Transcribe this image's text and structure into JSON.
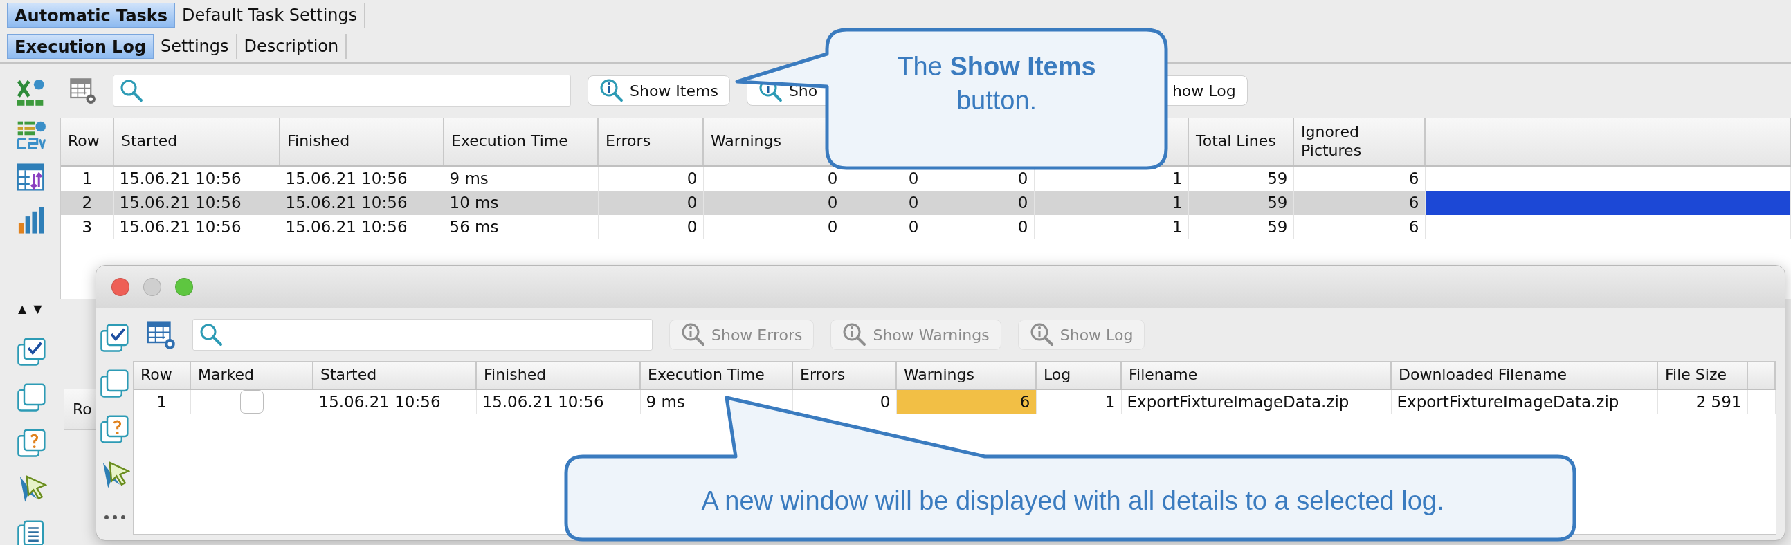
{
  "top_tabs": [
    {
      "label": "Automatic Tasks",
      "selected": true
    },
    {
      "label": "Default Task Settings",
      "selected": false
    }
  ],
  "sub_tabs": [
    {
      "label": "Execution Log",
      "selected": true
    },
    {
      "label": "Settings",
      "selected": false
    },
    {
      "label": "Description",
      "selected": false
    }
  ],
  "toolbar": {
    "buttons": [
      {
        "label": "Show Items",
        "disabled": false
      },
      {
        "label": "Sho",
        "disabled": false
      },
      {
        "label": "how Log",
        "disabled": false
      }
    ]
  },
  "table": {
    "columns": [
      "Row",
      "Started",
      "Finished",
      "Execution Time",
      "Errors",
      "Warnings",
      "",
      "",
      "",
      "Total Lines",
      "Ignored Pictures"
    ],
    "rows": [
      {
        "cells": [
          "1",
          "15.06.21 10:56",
          "15.06.21 10:56",
          "9 ms",
          "0",
          "0",
          "0",
          "0",
          "1",
          "59",
          "6"
        ],
        "selected": false
      },
      {
        "cells": [
          "2",
          "15.06.21 10:56",
          "15.06.21 10:56",
          "10 ms",
          "0",
          "0",
          "0",
          "0",
          "1",
          "59",
          "6"
        ],
        "selected": true
      },
      {
        "cells": [
          "3",
          "15.06.21 10:56",
          "15.06.21 10:56",
          "56 ms",
          "0",
          "0",
          "0",
          "0",
          "1",
          "59",
          "6"
        ],
        "selected": false
      }
    ]
  },
  "splitter": [
    "▲",
    "▼"
  ],
  "lower_table": {
    "columns": [
      "Ro"
    ]
  },
  "detail_window": {
    "toolbar": {
      "buttons": [
        {
          "label": "Show Errors",
          "disabled": true
        },
        {
          "label": "Show Warnings",
          "disabled": true
        },
        {
          "label": "Show Log",
          "disabled": true
        }
      ]
    },
    "table": {
      "columns": [
        "Row",
        "Marked",
        "Started",
        "Finished",
        "Execution Time",
        "Errors",
        "Warnings",
        "Log",
        "Filename",
        "Downloaded Filename",
        "File Size"
      ],
      "rows": [
        {
          "cells": [
            "1",
            "",
            "15.06.21 10:56",
            "15.06.21 10:56",
            "9 ms",
            "0",
            "6",
            "1",
            "ExportFixtureImageData.zip",
            "ExportFixtureImageData.zip",
            "2 591"
          ],
          "marked": false,
          "warnings_highlighted": true
        }
      ]
    }
  },
  "callouts": [
    {
      "text": "The **Show Items** button."
    },
    {
      "text": "A new window will be displayed with all details to a selected log."
    }
  ]
}
